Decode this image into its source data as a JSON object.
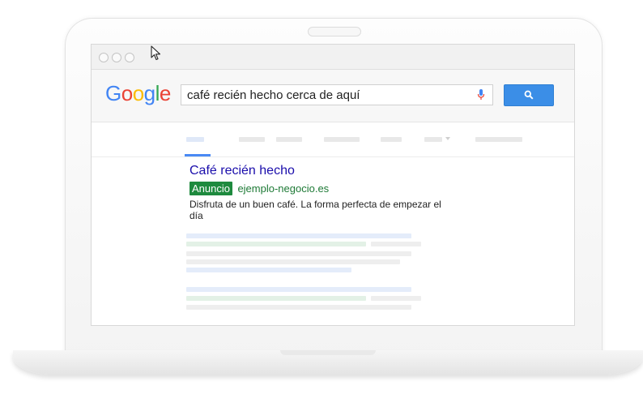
{
  "browser": {
    "window_dots": 3
  },
  "search": {
    "logo": {
      "letters": [
        {
          "ch": "G",
          "color": "#4285F4"
        },
        {
          "ch": "o",
          "color": "#EA4335"
        },
        {
          "ch": "o",
          "color": "#FBBC05"
        },
        {
          "ch": "g",
          "color": "#4285F4"
        },
        {
          "ch": "l",
          "color": "#34A853"
        },
        {
          "ch": "e",
          "color": "#EA4335"
        }
      ]
    },
    "query": "café recién hecho cerca de aquí",
    "button_color": "#3b8ee7",
    "mic_icon": "microphone-icon",
    "search_icon": "magnifier-icon"
  },
  "result": {
    "title": "Café recién hecho",
    "ad_badge": "Anuncio",
    "url": "ejemplo-negocio.es",
    "description": "Disfruta de un buen café. La forma perfecta de empezar el día",
    "title_color": "#1a0dab",
    "ad_color": "#1e8a3e"
  }
}
